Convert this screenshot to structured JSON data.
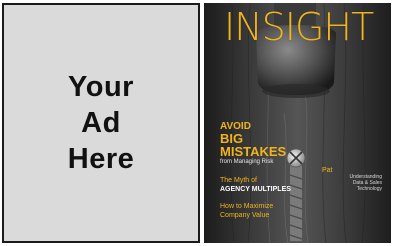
{
  "ad": {
    "line1": "Your",
    "line2": "Ad",
    "line3": "Here"
  },
  "magazine": {
    "title": "INSIGHT",
    "title_color": "#f0b51e",
    "headline": {
      "line1": "AVOID",
      "line2": "BIG",
      "line3": "MISTAKES",
      "sub": "from Managing Risk"
    },
    "story2": {
      "line1": "The Myth of",
      "line2": "AGENCY MULTIPLES"
    },
    "story3": {
      "line1": "How to Maximize",
      "line2": "Company Value"
    },
    "side_story": {
      "line1": "Pat",
      "line2": "Understanding",
      "line3": "Data & Sales",
      "line4": "Technology"
    }
  }
}
